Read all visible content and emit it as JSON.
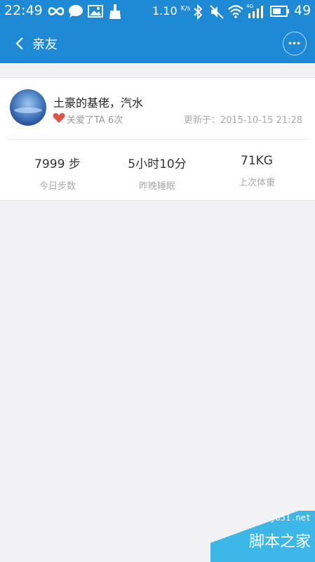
{
  "status_bar": {
    "time": "22:49",
    "net_speed": "1.10",
    "net_speed_unit": "K/s",
    "battery": "49",
    "network": "4G",
    "icons": [
      "infinity-icon",
      "message-icon",
      "image-icon",
      "broom-icon",
      "bluetooth-icon",
      "mute-icon",
      "wifi-icon",
      "signal-icon",
      "battery-icon"
    ]
  },
  "header": {
    "title": "亲友",
    "back_icon": "chevron-left-icon",
    "more_icon": "more-icon"
  },
  "friend": {
    "name": "土豪的基佬，汽水",
    "liked_text": "关爱了TA 6次",
    "updated_label": "更新于：",
    "updated_time": "2015-10-15 21:28",
    "stats": [
      {
        "value": "7999 步",
        "label": "今日步数"
      },
      {
        "value": "5小时10分",
        "label": "昨晚睡眠"
      },
      {
        "value": "71KG",
        "label": "上次体重"
      }
    ]
  },
  "watermark": {
    "url": "jb51.net",
    "site": "脚本之家"
  },
  "colors": {
    "primary": "#1e8ad6",
    "background": "#f2f2f4",
    "heart": "#e0554b"
  }
}
